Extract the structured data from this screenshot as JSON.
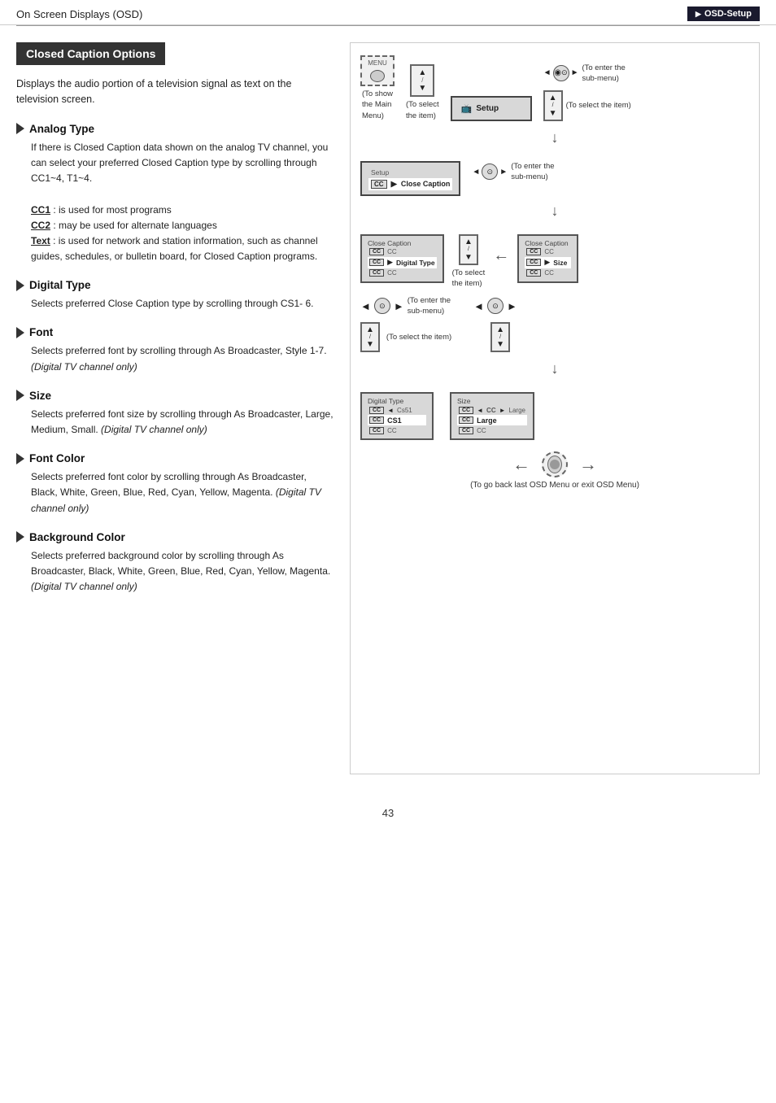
{
  "header": {
    "left_text": "On Screen Displays (OSD)",
    "right_text": "OSD-Setup"
  },
  "section": {
    "title": "Closed Caption Options",
    "intro": "Displays the audio portion of a television signal as text on the television screen.",
    "subsections": [
      {
        "id": "analog-type",
        "title": "Analog Type",
        "body": "If there is Closed Caption data shown on the analog TV channel, you can select your preferred Closed Caption type by scrolling through CC1~4, T1~4.",
        "details": [
          {
            "label": "CC1",
            "text": ": is used for most programs"
          },
          {
            "label": "CC2",
            "text": ": may be used for alternate languages"
          },
          {
            "label": "Text",
            "text": ": is used for network and station information, such as channel guides, schedules, or bulletin board, for Closed Caption programs."
          }
        ]
      },
      {
        "id": "digital-type",
        "title": "Digital Type",
        "body": "Selects preferred Close Caption type by scrolling through CS1- 6."
      },
      {
        "id": "font",
        "title": "Font",
        "body": "Selects preferred font by scrolling through As Broadcaster, Style 1-7.",
        "note": "(Digital TV channel only)"
      },
      {
        "id": "size",
        "title": "Size",
        "body": "Selects preferred font size by scrolling through As Broadcaster, Large, Medium, Small.",
        "note": "(Digital TV channel only)"
      },
      {
        "id": "font-color",
        "title": "Font Color",
        "body": "Selects preferred font color by scrolling through As Broadcaster, Black, White, Green, Blue, Red, Cyan, Yellow, Magenta.",
        "note": "(Digital TV channel only)"
      },
      {
        "id": "bg-color",
        "title": "Background Color",
        "body": "Selects preferred background color by scrolling through As Broadcaster, Black, White, Green, Blue, Red, Cyan, Yellow, Magenta.",
        "note": "(Digital TV channel only)"
      }
    ]
  },
  "diagram": {
    "to_show_main_menu": "To show\nthe Main\nMenu)",
    "to_select_item": "To select\nthe item)",
    "to_enter_submenu": "To enter the\nsub-menu)",
    "to_select_item2": "To select the item)",
    "to_enter_submenu2": "To enter the\nsub-menu)",
    "to_select_item3": "(To select\nthe item)",
    "to_go_back": "(To go back last OSD Menu or exit OSD Menu)",
    "setup_label": "Setup",
    "close_caption_label": "Close Caption",
    "digital_type_label": "Digital Type",
    "size_label": "Size",
    "cs1_label": "CS1",
    "large_label": "Large"
  },
  "page_number": "43"
}
